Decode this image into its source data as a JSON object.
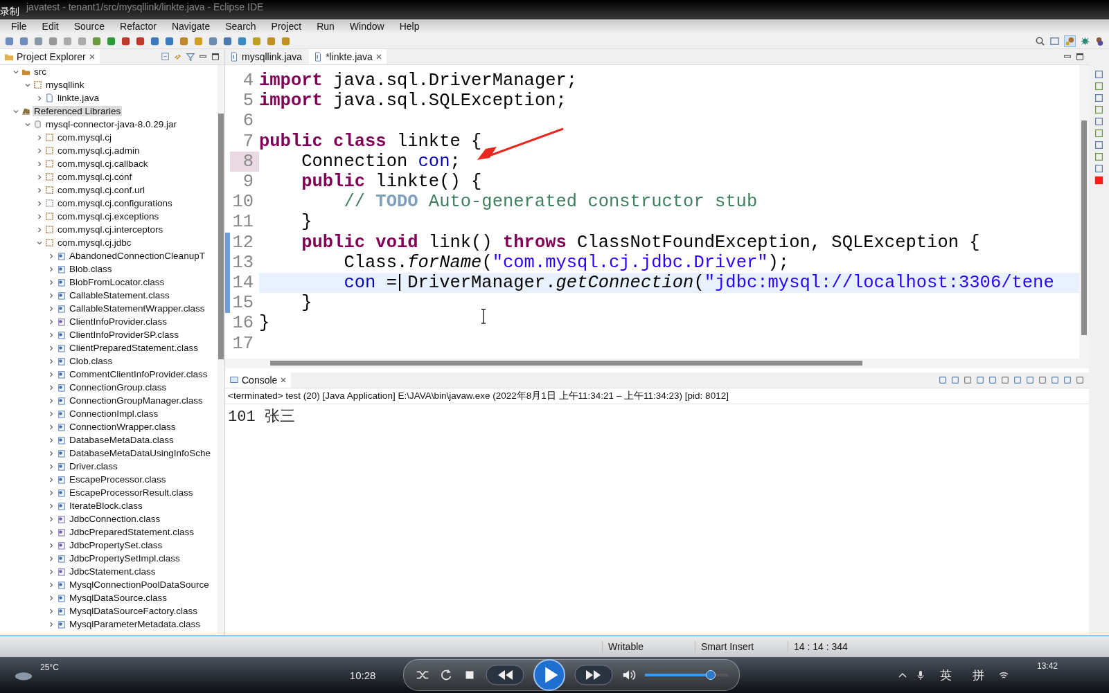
{
  "recording_label": "录制",
  "window": {
    "title": "javatest - tenant1/src/mysqllink/linkte.java - Eclipse IDE"
  },
  "menu": [
    "File",
    "Edit",
    "Source",
    "Refactor",
    "Navigate",
    "Search",
    "Project",
    "Run",
    "Window",
    "Help"
  ],
  "explorer": {
    "title": "Project Explorer",
    "tree": [
      {
        "label": "src",
        "kind": "folder",
        "expanded": true,
        "selected": false,
        "children": [
          {
            "label": "mysqllink",
            "kind": "package",
            "expanded": true,
            "selected": false,
            "children": [
              {
                "label": "linkte.java",
                "kind": "java",
                "expanded": false,
                "selected": false
              }
            ]
          }
        ]
      },
      {
        "label": "Referenced Libraries",
        "kind": "library",
        "expanded": true,
        "selected": true,
        "children": [
          {
            "label": "mysql-connector-java-8.0.29.jar",
            "kind": "jar",
            "expanded": true,
            "selected": false,
            "children": [
              {
                "label": "com.mysql.cj",
                "kind": "package",
                "expanded": false,
                "selected": false
              },
              {
                "label": "com.mysql.cj.admin",
                "kind": "package",
                "expanded": false,
                "selected": false
              },
              {
                "label": "com.mysql.cj.callback",
                "kind": "package",
                "expanded": false,
                "selected": false
              },
              {
                "label": "com.mysql.cj.conf",
                "kind": "package",
                "expanded": false,
                "selected": false
              },
              {
                "label": "com.mysql.cj.conf.url",
                "kind": "package",
                "expanded": false,
                "selected": false
              },
              {
                "label": "com.mysql.cj.configurations",
                "kind": "folder-plain",
                "expanded": false,
                "selected": false
              },
              {
                "label": "com.mysql.cj.exceptions",
                "kind": "package",
                "expanded": false,
                "selected": false
              },
              {
                "label": "com.mysql.cj.interceptors",
                "kind": "package",
                "expanded": false,
                "selected": false
              },
              {
                "label": "com.mysql.cj.jdbc",
                "kind": "package",
                "expanded": true,
                "selected": false,
                "children": [
                  {
                    "label": "AbandonedConnectionCleanupT",
                    "kind": "class",
                    "expanded": false,
                    "selected": false
                  },
                  {
                    "label": "Blob.class",
                    "kind": "class",
                    "expanded": false,
                    "selected": false
                  },
                  {
                    "label": "BlobFromLocator.class",
                    "kind": "class",
                    "expanded": false,
                    "selected": false
                  },
                  {
                    "label": "CallableStatement.class",
                    "kind": "class",
                    "expanded": false,
                    "selected": false
                  },
                  {
                    "label": "CallableStatementWrapper.class",
                    "kind": "class",
                    "expanded": false,
                    "selected": false
                  },
                  {
                    "label": "ClientInfoProvider.class",
                    "kind": "interface",
                    "expanded": false,
                    "selected": false
                  },
                  {
                    "label": "ClientInfoProviderSP.class",
                    "kind": "class",
                    "expanded": false,
                    "selected": false
                  },
                  {
                    "label": "ClientPreparedStatement.class",
                    "kind": "class",
                    "expanded": false,
                    "selected": false
                  },
                  {
                    "label": "Clob.class",
                    "kind": "class",
                    "expanded": false,
                    "selected": false
                  },
                  {
                    "label": "CommentClientInfoProvider.class",
                    "kind": "class",
                    "expanded": false,
                    "selected": false
                  },
                  {
                    "label": "ConnectionGroup.class",
                    "kind": "class",
                    "expanded": false,
                    "selected": false
                  },
                  {
                    "label": "ConnectionGroupManager.class",
                    "kind": "class",
                    "expanded": false,
                    "selected": false
                  },
                  {
                    "label": "ConnectionImpl.class",
                    "kind": "class",
                    "expanded": false,
                    "selected": false
                  },
                  {
                    "label": "ConnectionWrapper.class",
                    "kind": "class",
                    "expanded": false,
                    "selected": false
                  },
                  {
                    "label": "DatabaseMetaData.class",
                    "kind": "class",
                    "expanded": false,
                    "selected": false
                  },
                  {
                    "label": "DatabaseMetaDataUsingInfoSche",
                    "kind": "class",
                    "expanded": false,
                    "selected": false
                  },
                  {
                    "label": "Driver.class",
                    "kind": "class",
                    "expanded": false,
                    "selected": false
                  },
                  {
                    "label": "EscapeProcessor.class",
                    "kind": "class",
                    "expanded": false,
                    "selected": false
                  },
                  {
                    "label": "EscapeProcessorResult.class",
                    "kind": "class",
                    "expanded": false,
                    "selected": false
                  },
                  {
                    "label": "IterateBlock.class",
                    "kind": "class",
                    "expanded": false,
                    "selected": false
                  },
                  {
                    "label": "JdbcConnection.class",
                    "kind": "interface",
                    "expanded": false,
                    "selected": false
                  },
                  {
                    "label": "JdbcPreparedStatement.class",
                    "kind": "interface",
                    "expanded": false,
                    "selected": false
                  },
                  {
                    "label": "JdbcPropertySet.class",
                    "kind": "interface",
                    "expanded": false,
                    "selected": false
                  },
                  {
                    "label": "JdbcPropertySetImpl.class",
                    "kind": "class",
                    "expanded": false,
                    "selected": false
                  },
                  {
                    "label": "JdbcStatement.class",
                    "kind": "interface",
                    "expanded": false,
                    "selected": false
                  },
                  {
                    "label": "MysqlConnectionPoolDataSource",
                    "kind": "class",
                    "expanded": false,
                    "selected": false
                  },
                  {
                    "label": "MysqlDataSource.class",
                    "kind": "class",
                    "expanded": false,
                    "selected": false
                  },
                  {
                    "label": "MysqlDataSourceFactory.class",
                    "kind": "class",
                    "expanded": false,
                    "selected": false
                  },
                  {
                    "label": "MysqlParameterMetadata.class",
                    "kind": "class",
                    "expanded": false,
                    "selected": false
                  }
                ]
              }
            ]
          }
        ]
      }
    ]
  },
  "editor": {
    "tabs": [
      {
        "label": "mysqllink.java",
        "selected": false
      },
      {
        "label": "*linkte.java",
        "selected": true
      }
    ],
    "lines": [
      {
        "number": "4",
        "changed": false,
        "current": false,
        "marked": false,
        "tokens": [
          {
            "kind": "kw",
            "text": "import"
          },
          {
            "kind": "plain",
            "text": " java.sql.DriverManager;"
          }
        ]
      },
      {
        "number": "5",
        "changed": false,
        "current": false,
        "marked": false,
        "tokens": [
          {
            "kind": "kw",
            "text": "import"
          },
          {
            "kind": "plain",
            "text": " java.sql.SQLException;"
          }
        ]
      },
      {
        "number": "6",
        "changed": false,
        "current": false,
        "marked": false
      },
      {
        "number": "7",
        "changed": false,
        "current": false,
        "marked": false,
        "tokens": [
          {
            "kind": "kw",
            "text": "public class"
          },
          {
            "kind": "plain",
            "text": " linkte {"
          }
        ]
      },
      {
        "number": "8",
        "changed": false,
        "current": false,
        "marked": true,
        "tokens": [
          {
            "kind": "plain",
            "text": "    Connection "
          },
          {
            "kind": "field",
            "text": "con"
          },
          {
            "kind": "plain",
            "text": ";"
          }
        ]
      },
      {
        "number": "9",
        "changed": false,
        "current": false,
        "marked": false,
        "tokens": [
          {
            "kind": "kw",
            "text": "    public"
          },
          {
            "kind": "plain",
            "text": " linkte() {"
          }
        ]
      },
      {
        "number": "10",
        "changed": false,
        "current": false,
        "marked": false,
        "tokens": [
          {
            "kind": "comment",
            "text": "        // "
          },
          {
            "kind": "todo",
            "text": "TODO"
          },
          {
            "kind": "comment",
            "text": " Auto-generated constructor stub"
          }
        ]
      },
      {
        "number": "11",
        "changed": false,
        "current": false,
        "marked": false,
        "tokens": [
          {
            "kind": "plain",
            "text": "    }"
          }
        ]
      },
      {
        "number": "12",
        "changed": true,
        "current": false,
        "marked": false,
        "tokens": [
          {
            "kind": "kw",
            "text": "    public void"
          },
          {
            "kind": "plain",
            "text": " link() "
          },
          {
            "kind": "kw",
            "text": "throws"
          },
          {
            "kind": "plain",
            "text": " ClassNotFoundException, SQLException {"
          }
        ]
      },
      {
        "number": "13",
        "changed": true,
        "current": false,
        "marked": false,
        "tokens": [
          {
            "kind": "plain",
            "text": "        Class."
          },
          {
            "kind": "method",
            "text": "forName"
          },
          {
            "kind": "plain",
            "text": "("
          },
          {
            "kind": "string",
            "text": "\"com.mysql.cj.jdbc.Driver\""
          },
          {
            "kind": "plain",
            "text": ");"
          }
        ]
      },
      {
        "number": "14",
        "changed": true,
        "current": true,
        "marked": false,
        "tokens": [
          {
            "kind": "field",
            "text": "        con"
          },
          {
            "kind": "plain",
            "text": " =",
            "cursor": true
          },
          {
            "kind": "plain",
            "text": " DriverManager."
          },
          {
            "kind": "method",
            "text": "getConnection"
          },
          {
            "kind": "plain",
            "text": "("
          },
          {
            "kind": "string",
            "text": "\"jdbc:mysql://localhost:3306/tene"
          }
        ]
      },
      {
        "number": "15",
        "changed": true,
        "current": false,
        "marked": false,
        "tokens": [
          {
            "kind": "plain",
            "text": "    }"
          }
        ]
      },
      {
        "number": "16",
        "changed": false,
        "current": false,
        "marked": false,
        "tokens": [
          {
            "kind": "plain",
            "text": "}"
          }
        ]
      },
      {
        "number": "17",
        "changed": false,
        "current": false,
        "marked": false
      }
    ]
  },
  "console": {
    "title": "Console",
    "info": "<terminated> test (20) [Java Application] E:\\JAVA\\bin\\javaw.exe  (2022年8月1日 上午11:34:21 – 上午11:34:23) [pid: 8012]",
    "output": "101 张三"
  },
  "status_bar": [
    "Writable",
    "Smart Insert",
    "14 : 14 : 344"
  ],
  "player": {
    "weather": "25°C",
    "elapsed": "10:28"
  },
  "taskbar": {
    "ime": [
      "英",
      "拼"
    ],
    "clock": "13:42"
  }
}
